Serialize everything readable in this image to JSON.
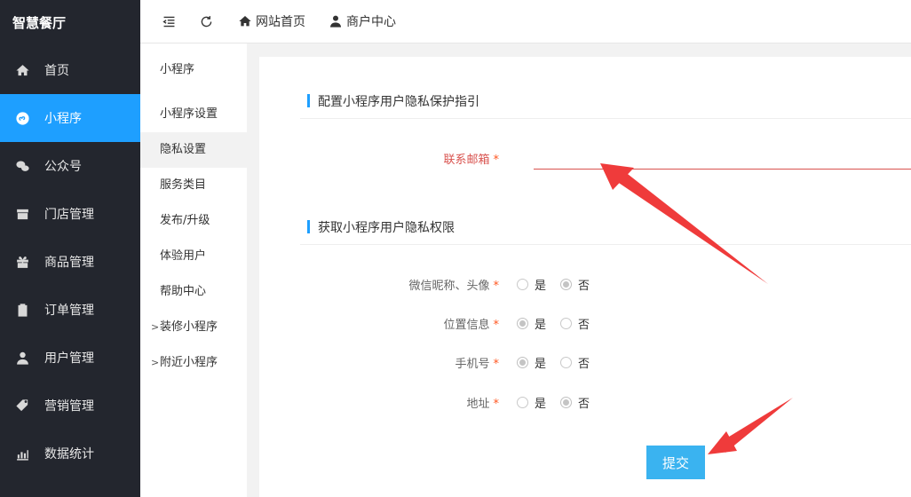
{
  "brand": "智慧餐厅",
  "sidebar": {
    "items": [
      {
        "label": "首页",
        "icon": "home-icon",
        "active": false
      },
      {
        "label": "小程序",
        "icon": "miniprogram-icon",
        "active": true
      },
      {
        "label": "公众号",
        "icon": "wechat-icon",
        "active": false
      },
      {
        "label": "门店管理",
        "icon": "store-icon",
        "active": false
      },
      {
        "label": "商品管理",
        "icon": "gift-icon",
        "active": false
      },
      {
        "label": "订单管理",
        "icon": "clipboard-icon",
        "active": false
      },
      {
        "label": "用户管理",
        "icon": "user-icon",
        "active": false
      },
      {
        "label": "营销管理",
        "icon": "tag-icon",
        "active": false
      },
      {
        "label": "数据统计",
        "icon": "chart-icon",
        "active": false
      }
    ]
  },
  "header": {
    "links": [
      {
        "label": "网站首页",
        "icon": "home-icon"
      },
      {
        "label": "商户中心",
        "icon": "user-icon"
      }
    ]
  },
  "submenu": {
    "title": "小程序",
    "items": [
      {
        "label": "小程序设置"
      },
      {
        "label": "隐私设置",
        "active": true
      },
      {
        "label": "服务类目"
      },
      {
        "label": "发布/升级"
      },
      {
        "label": "体验用户"
      },
      {
        "label": "帮助中心"
      }
    ],
    "groups": [
      {
        "label": "装修小程序"
      },
      {
        "label": "附近小程序"
      }
    ]
  },
  "form": {
    "section1_title": "配置小程序用户隐私保护指引",
    "email_label": "联系邮箱",
    "email_value": "",
    "section2_title": "获取小程序用户隐私权限",
    "required_mark": "*",
    "yes": "是",
    "no": "否",
    "permissions": [
      {
        "label": "微信昵称、头像",
        "selected": "否"
      },
      {
        "label": "位置信息",
        "selected": "是"
      },
      {
        "label": "手机号",
        "selected": "是"
      },
      {
        "label": "地址",
        "selected": "否"
      }
    ],
    "submit_label": "提交"
  },
  "colors": {
    "sidebar_bg": "#23262e",
    "accent": "#1e9fff",
    "submit_bg": "#3ab3f0",
    "error": "#d9534f",
    "annotation_arrow": "#ef3b3b"
  }
}
